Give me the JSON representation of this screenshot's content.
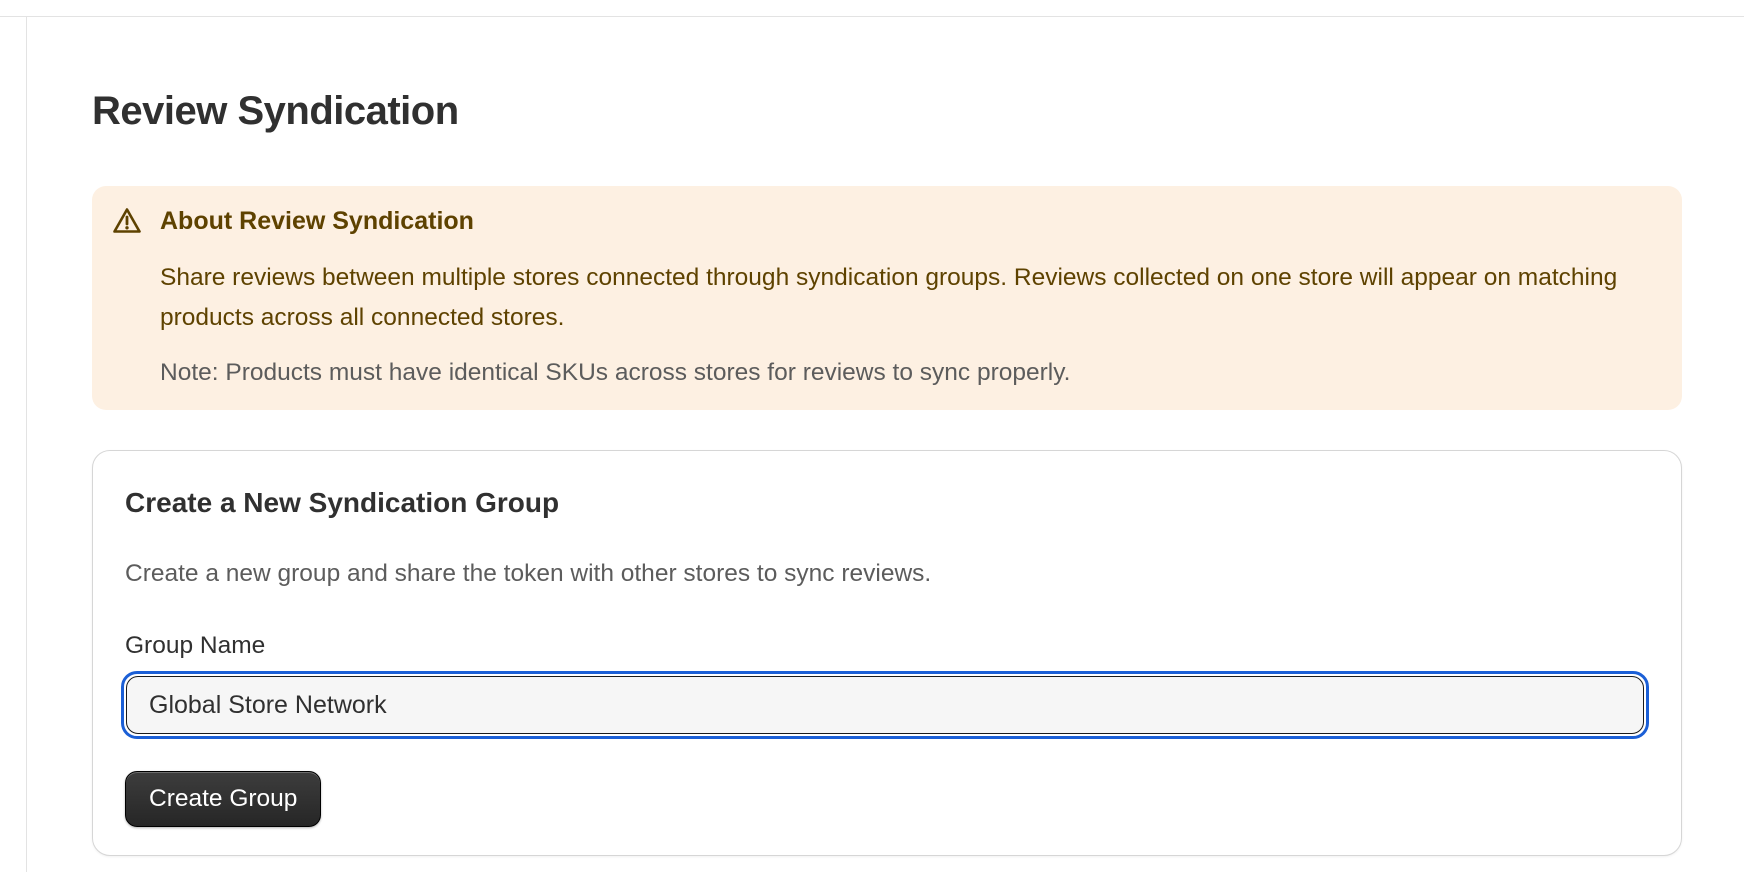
{
  "page": {
    "title": "Review Syndication"
  },
  "banner": {
    "icon": "alert-triangle-icon",
    "title": "About Review Syndication",
    "body": "Share reviews between multiple stores connected through syndication groups. Reviews collected on one store will appear on matching products across all connected stores.",
    "note": "Note: Products must have identical SKUs across stores for reviews to sync properly.",
    "background_color": "#fdf0e2",
    "text_color": "#5e4200"
  },
  "create_group": {
    "title": "Create a New Syndication Group",
    "description": "Create a new group and share the token with other stores to sync reviews.",
    "field_label": "Group Name",
    "group_name_value": "Global Store Network",
    "button_label": "Create Group",
    "focus_color": "#1b5fd6"
  }
}
